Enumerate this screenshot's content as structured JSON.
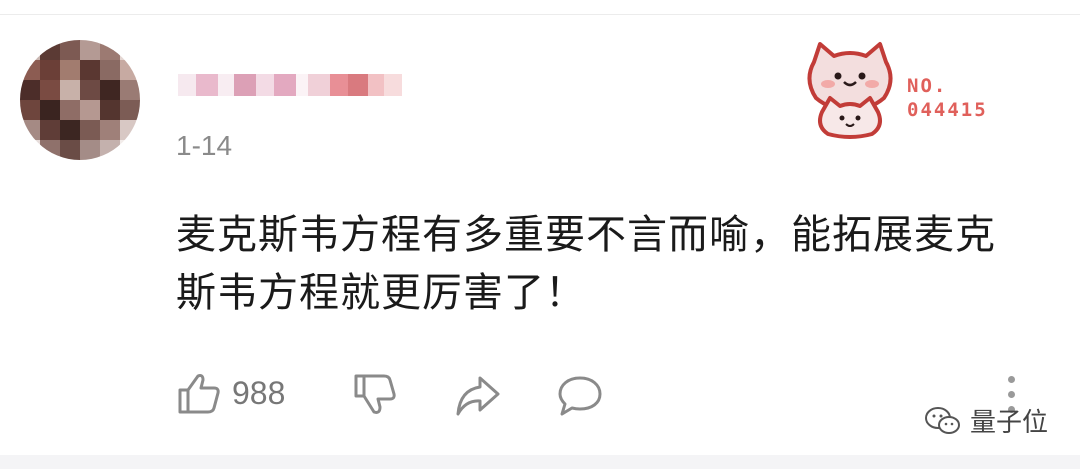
{
  "comment": {
    "date": "1-14",
    "text_line1": "麦克斯韦方程有多重要不言而喻，能拓展麦克",
    "text_line2": "斯韦方程就更厉害了！"
  },
  "badge": {
    "label_no": "NO.",
    "label_number": "044415"
  },
  "actions": {
    "like_count": "988"
  },
  "watermark": {
    "text": "量子位"
  },
  "colors": {
    "badge_text": "#e0605b",
    "date_text": "#8a8a8a",
    "action_icon": "#8a8a8a"
  }
}
